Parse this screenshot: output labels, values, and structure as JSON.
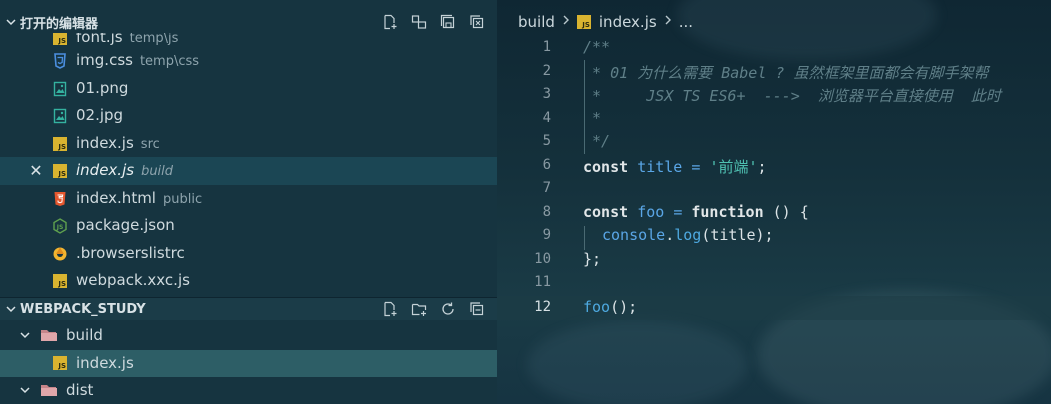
{
  "open_editors": {
    "title": "打开的编辑器",
    "items": [
      {
        "name": "font.js",
        "desc": "temp\\js",
        "icon": "js-icon"
      },
      {
        "name": "img.css",
        "desc": "temp\\css",
        "icon": "css-icon"
      },
      {
        "name": "01.png",
        "desc": "",
        "icon": "image-icon"
      },
      {
        "name": "02.jpg",
        "desc": "",
        "icon": "image-icon"
      },
      {
        "name": "index.js",
        "desc": "src",
        "icon": "js-icon"
      },
      {
        "name": "index.js",
        "desc": "build",
        "icon": "js-icon",
        "active": true
      },
      {
        "name": "index.html",
        "desc": "public",
        "icon": "html-icon"
      },
      {
        "name": "package.json",
        "desc": "",
        "icon": "node-icon"
      },
      {
        "name": ".browserslistrc",
        "desc": "",
        "icon": "browserslist-icon"
      },
      {
        "name": "webpack.xxc.js",
        "desc": "",
        "icon": "js-icon"
      }
    ]
  },
  "explorer": {
    "title": "WEBPACK_STUDY",
    "tree": [
      {
        "name": "build",
        "type": "folder",
        "expanded": true
      },
      {
        "name": "index.js",
        "type": "file",
        "selected": true
      },
      {
        "name": "dist",
        "type": "folder",
        "expanded": true
      }
    ]
  },
  "breadcrumb": {
    "folder": "build",
    "file": "index.js",
    "more": "..."
  },
  "code": {
    "line_numbers": [
      "1",
      "2",
      "3",
      "4",
      "5",
      "6",
      "7",
      "8",
      "9",
      "10",
      "11",
      "12"
    ],
    "l1": "/**",
    "l2": " * 01 为什么需要 Babel ? 虽然框架里面都会有脚手架帮",
    "l3": " *     JSX TS ES6+  --->  浏览器平台直接使用  此时",
    "l4": " *",
    "l5": " */",
    "l6": {
      "kw": "const",
      "var": "title",
      "op": "=",
      "str": "'前端'",
      "end": ";"
    },
    "l8": {
      "kw": "const",
      "var": "foo",
      "op": "=",
      "kw2": "function",
      "rest": " () {"
    },
    "l9": {
      "obj": "console",
      "dot": ".",
      "fn": "log",
      "rest": "(title);"
    },
    "l10": "};",
    "l12": {
      "fn": "foo",
      "rest": "();"
    }
  },
  "colors": {
    "sidebar_bg": "#163440",
    "active_row": "#1b4654",
    "selected_row": "#2d5e66",
    "js_badge": "#d9b430",
    "string": "#4fc1b2",
    "variable": "#5aa6e6"
  }
}
